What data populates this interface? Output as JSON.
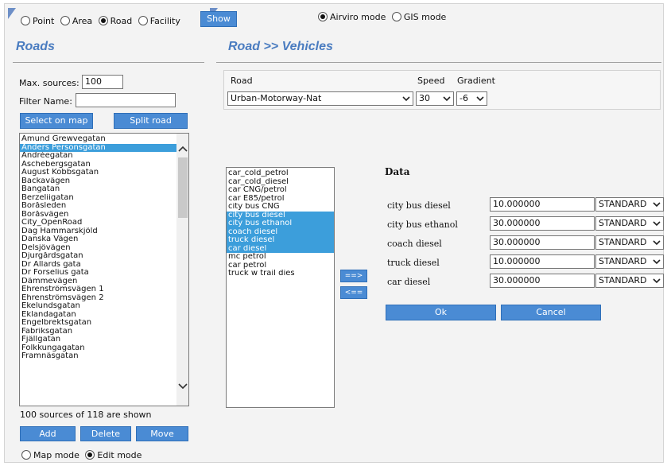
{
  "top": {
    "layer_options": [
      {
        "label": "Point",
        "checked": false
      },
      {
        "label": "Area",
        "checked": false
      },
      {
        "label": "Road",
        "checked": true
      },
      {
        "label": "Facility",
        "checked": false
      }
    ],
    "show_label": "Show",
    "mode_options": [
      {
        "label": "Airviro mode",
        "checked": true
      },
      {
        "label": "GIS mode",
        "checked": false
      }
    ]
  },
  "left": {
    "title": "Roads",
    "max_sources_label": "Max. sources:",
    "max_sources_value": "100",
    "filter_label": "Filter Name:",
    "filter_value": "",
    "select_on_map_label": "Select on map",
    "split_road_label": "Split road",
    "roads": [
      {
        "label": "Amund Grewvegatan",
        "selected": false
      },
      {
        "label": "Anders Personsgatan",
        "selected": true
      },
      {
        "label": "Andréegatan",
        "selected": false
      },
      {
        "label": "Aschebergsgatan",
        "selected": false
      },
      {
        "label": "August Kobbsgatan",
        "selected": false
      },
      {
        "label": "Backavägen",
        "selected": false
      },
      {
        "label": "Bangatan",
        "selected": false
      },
      {
        "label": "Berzeliigatan",
        "selected": false
      },
      {
        "label": "Boråsleden",
        "selected": false
      },
      {
        "label": "Boråsvägen",
        "selected": false
      },
      {
        "label": "City_OpenRoad",
        "selected": false
      },
      {
        "label": "Dag Hammarskjöld",
        "selected": false
      },
      {
        "label": "Danska Vägen",
        "selected": false
      },
      {
        "label": "Delsjövägen",
        "selected": false
      },
      {
        "label": "Djurgårdsgatan",
        "selected": false
      },
      {
        "label": "Dr Allards gata",
        "selected": false
      },
      {
        "label": "Dr Forselius gata",
        "selected": false
      },
      {
        "label": "Dämmevägen",
        "selected": false
      },
      {
        "label": "Ehrenströmsvägen 1",
        "selected": false
      },
      {
        "label": "Ehrenströmsvägen 2",
        "selected": false
      },
      {
        "label": "Ekelundsgatan",
        "selected": false
      },
      {
        "label": "Eklandagatan",
        "selected": false
      },
      {
        "label": "Engelbrektsgatan",
        "selected": false
      },
      {
        "label": "Fabriksgatan",
        "selected": false
      },
      {
        "label": "Fjällgatan",
        "selected": false
      },
      {
        "label": "Folkkungagatan",
        "selected": false
      },
      {
        "label": "Framnäsgatan",
        "selected": false
      }
    ],
    "count_text": "100 sources of 118 are shown",
    "add_label": "Add",
    "delete_label": "Delete",
    "move_label": "Move",
    "edit_modes": [
      {
        "label": "Map mode",
        "checked": false
      },
      {
        "label": "Edit mode",
        "checked": true
      }
    ]
  },
  "right": {
    "title": "Road >> Vehicles",
    "road_label": "Road",
    "road_value": "Urban-Motorway-Nat",
    "speed_label": "Speed",
    "speed_value": "30",
    "gradient_label": "Gradient",
    "gradient_value": "-6",
    "vehicles": [
      {
        "label": "car_cold_petrol",
        "selected": false
      },
      {
        "label": "car_cold_diesel",
        "selected": false
      },
      {
        "label": "car CNG/petrol",
        "selected": false
      },
      {
        "label": "car E85/petrol",
        "selected": false
      },
      {
        "label": "city bus CNG",
        "selected": false
      },
      {
        "label": "city bus diesel",
        "selected": true
      },
      {
        "label": "city bus ethanol",
        "selected": true
      },
      {
        "label": "coach diesel",
        "selected": true
      },
      {
        "label": "truck diesel",
        "selected": true
      },
      {
        "label": "car diesel",
        "selected": true
      },
      {
        "label": "mc petrol",
        "selected": false
      },
      {
        "label": "car petrol",
        "selected": false
      },
      {
        "label": "truck w trail dies",
        "selected": false
      }
    ],
    "move_right_label": "==>",
    "move_left_label": "<==",
    "data_title": "Data",
    "data_rows": [
      {
        "label": "city bus diesel",
        "value": "10.000000",
        "type": "STANDARD"
      },
      {
        "label": "city bus ethanol",
        "value": "30.000000",
        "type": "STANDARD"
      },
      {
        "label": "coach diesel",
        "value": "30.000000",
        "type": "STANDARD"
      },
      {
        "label": "truck diesel",
        "value": "10.000000",
        "type": "STANDARD"
      },
      {
        "label": "car diesel",
        "value": "30.000000",
        "type": "STANDARD"
      }
    ],
    "ok_label": "Ok",
    "cancel_label": "Cancel"
  },
  "colors": {
    "accent": "#4a8bd4",
    "title": "#4a7cc0",
    "selection": "#3c9edb"
  }
}
